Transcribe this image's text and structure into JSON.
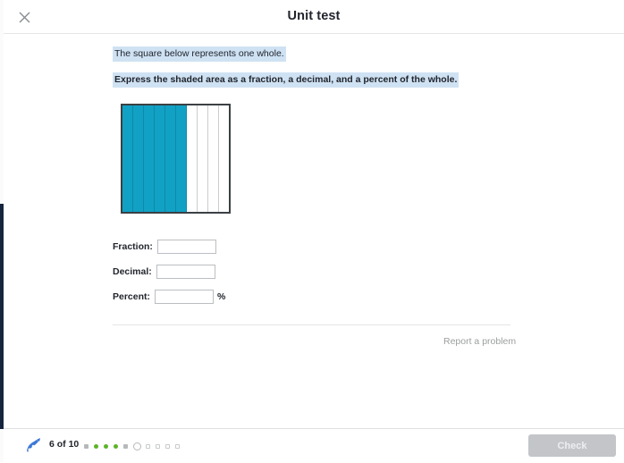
{
  "header": {
    "title": "Unit test",
    "close_icon": "close-icon"
  },
  "question": {
    "line1": "The square below represents one whole.",
    "line2": "Express the shaded area as a fraction, a decimal, and a percent of the whole."
  },
  "figure": {
    "total_columns": 10,
    "shaded_columns": 6,
    "shaded_color": "#11a1c4",
    "border_color": "#3b4044",
    "grid_color": "#c9cdd1"
  },
  "answers": [
    {
      "label": "Fraction:",
      "value": "",
      "placeholder": "",
      "suffix": ""
    },
    {
      "label": "Decimal:",
      "value": "",
      "placeholder": "",
      "suffix": ""
    },
    {
      "label": "Percent:",
      "value": "",
      "placeholder": "",
      "suffix": "%"
    }
  ],
  "report_link": "Report a problem",
  "footer": {
    "logo_icon": "khan-logo-icon",
    "progress_label": "6 of 10",
    "check_label": "Check",
    "dots": [
      {
        "state": "skipped"
      },
      {
        "state": "correct"
      },
      {
        "state": "correct"
      },
      {
        "state": "correct"
      },
      {
        "state": "skipped"
      },
      {
        "state": "current"
      },
      {
        "state": "upcoming"
      },
      {
        "state": "upcoming"
      },
      {
        "state": "upcoming"
      },
      {
        "state": "upcoming"
      }
    ]
  }
}
